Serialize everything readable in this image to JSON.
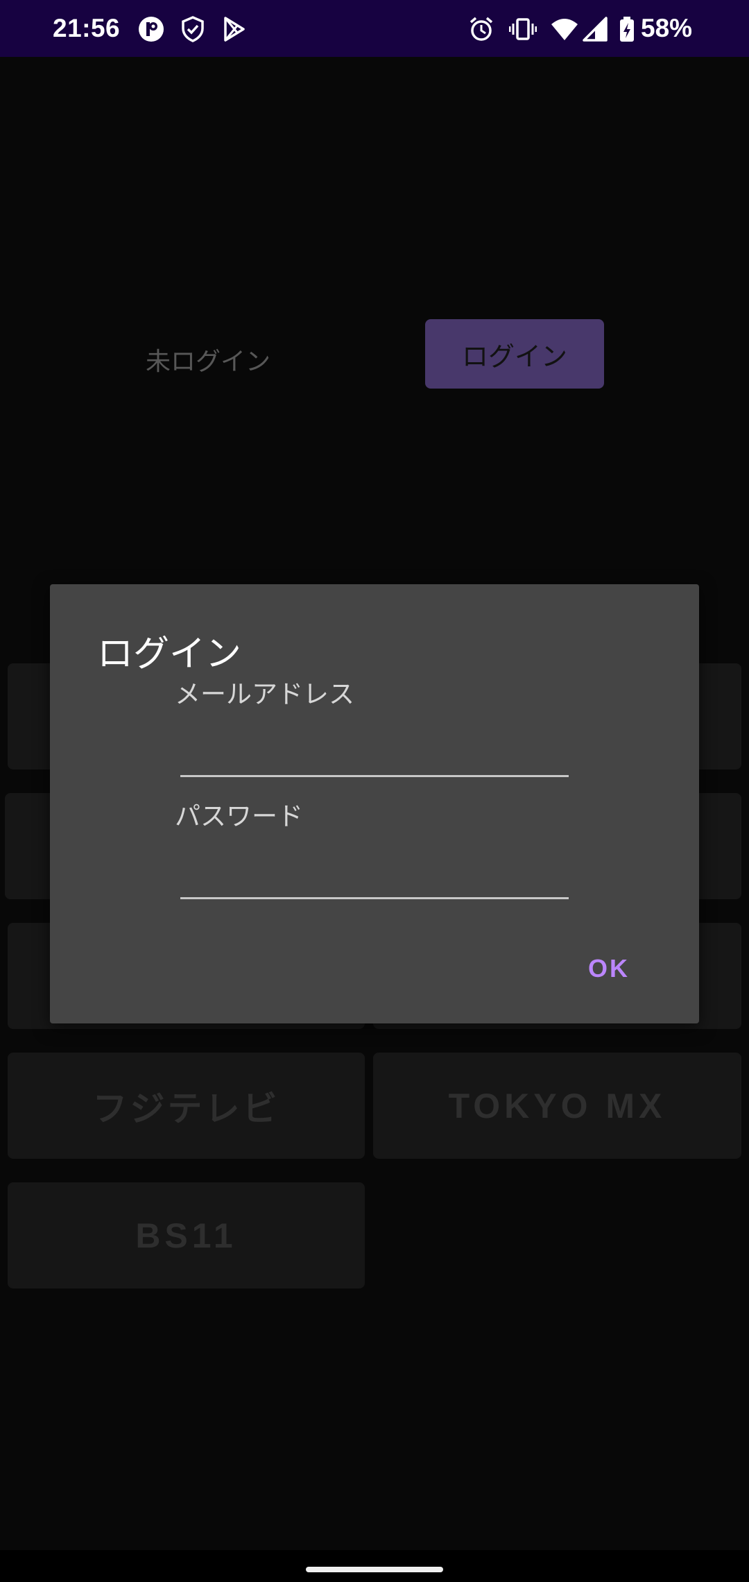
{
  "status_bar": {
    "time": "21:56",
    "battery_percent": "58%",
    "background_color": "#170241"
  },
  "main": {
    "login_status": "未ログイン",
    "login_button_label": "ログイン"
  },
  "channels": [
    {
      "label": ""
    },
    {
      "label": ""
    },
    {
      "label": ""
    },
    {
      "label": ""
    },
    {
      "label": ""
    },
    {
      "label": ""
    },
    {
      "label": "フジテレビ"
    },
    {
      "label": "TOKYO MX"
    },
    {
      "label": "BS11"
    }
  ],
  "dialog": {
    "title": "ログイン",
    "email_label": "メールアドレス",
    "email_value": "",
    "password_label": "パスワード",
    "password_value": "",
    "ok_label": "OK",
    "accent_color": "#bb86fc"
  }
}
